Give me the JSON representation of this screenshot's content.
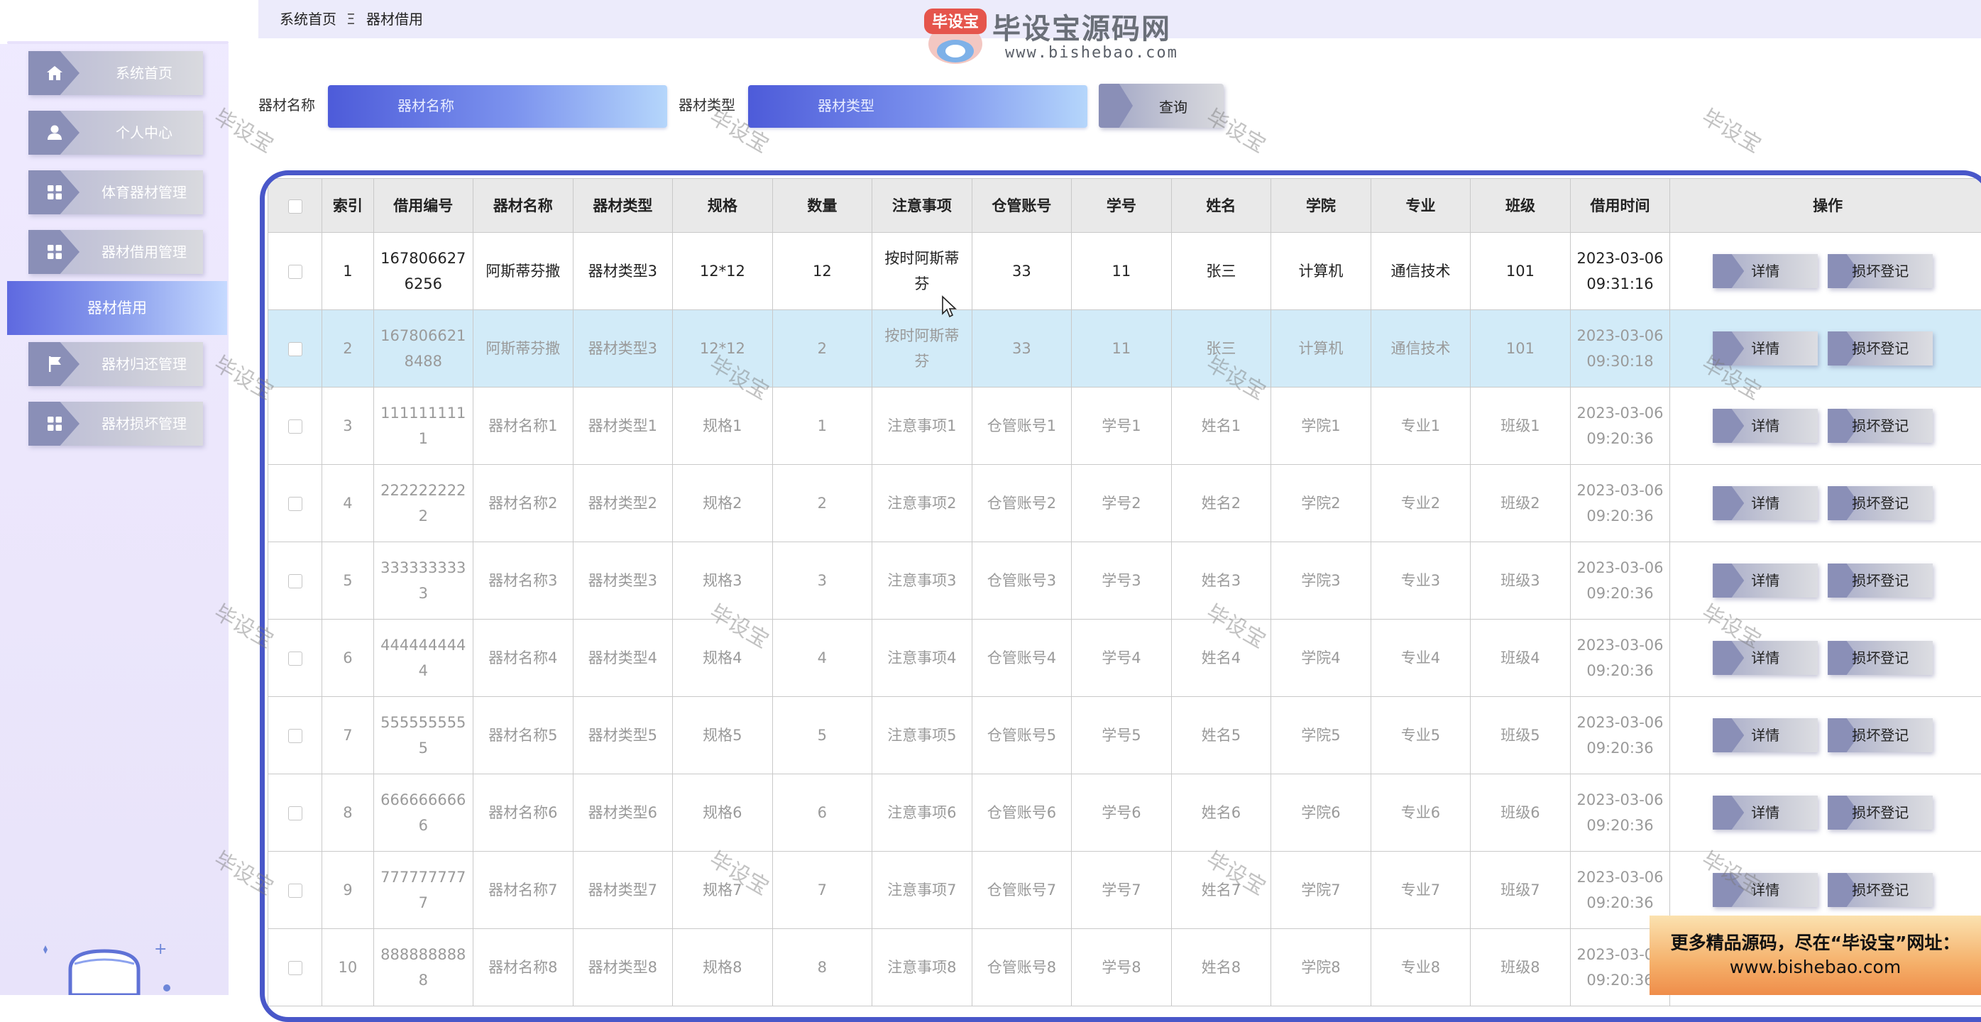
{
  "breadcrumb": {
    "home": "系统首页",
    "separator": "Ξ",
    "current": "器材借用"
  },
  "logo": {
    "badge_text": "毕设宝",
    "title": "毕设宝源码网",
    "url": "www.bishebao.com"
  },
  "sidebar": {
    "items": [
      {
        "label": "系统首页",
        "icon": "home-icon"
      },
      {
        "label": "个人中心",
        "icon": "user-icon"
      },
      {
        "label": "体育器材管理",
        "icon": "grid-icon"
      },
      {
        "label": "器材借用管理",
        "icon": "grid-icon"
      },
      {
        "label": "器材归还管理",
        "icon": "flag-icon"
      },
      {
        "label": "器材损坏管理",
        "icon": "grid-icon"
      }
    ],
    "active": "器材借用"
  },
  "search": {
    "name_label": "器材名称",
    "name_placeholder": "器材名称",
    "type_label": "器材类型",
    "type_placeholder": "器材类型",
    "query_label": "查询"
  },
  "table": {
    "headers": [
      "索引",
      "借用编号",
      "器材名称",
      "器材类型",
      "规格",
      "数量",
      "注意事项",
      "仓管账号",
      "学号",
      "姓名",
      "学院",
      "专业",
      "班级",
      "借用时间",
      "操作"
    ],
    "detail_label": "详情",
    "damage_label": "损坏登记",
    "rows": [
      [
        "1",
        "1678066276256",
        "阿斯蒂芬撒",
        "器材类型3",
        "12*12",
        "12",
        "按时阿斯蒂芬",
        "33",
        "11",
        "张三",
        "计算机",
        "通信技术",
        "101",
        "2023-03-06 09:31:16"
      ],
      [
        "2",
        "1678066218488",
        "阿斯蒂芬撒",
        "器材类型3",
        "12*12",
        "2",
        "按时阿斯蒂芬",
        "33",
        "11",
        "张三",
        "计算机",
        "通信技术",
        "101",
        "2023-03-06 09:30:18"
      ],
      [
        "3",
        "1111111111",
        "器材名称1",
        "器材类型1",
        "规格1",
        "1",
        "注意事项1",
        "仓管账号1",
        "学号1",
        "姓名1",
        "学院1",
        "专业1",
        "班级1",
        "2023-03-06 09:20:36"
      ],
      [
        "4",
        "2222222222",
        "器材名称2",
        "器材类型2",
        "规格2",
        "2",
        "注意事项2",
        "仓管账号2",
        "学号2",
        "姓名2",
        "学院2",
        "专业2",
        "班级2",
        "2023-03-06 09:20:36"
      ],
      [
        "5",
        "3333333333",
        "器材名称3",
        "器材类型3",
        "规格3",
        "3",
        "注意事项3",
        "仓管账号3",
        "学号3",
        "姓名3",
        "学院3",
        "专业3",
        "班级3",
        "2023-03-06 09:20:36"
      ],
      [
        "6",
        "4444444444",
        "器材名称4",
        "器材类型4",
        "规格4",
        "4",
        "注意事项4",
        "仓管账号4",
        "学号4",
        "姓名4",
        "学院4",
        "专业4",
        "班级4",
        "2023-03-06 09:20:36"
      ],
      [
        "7",
        "5555555555",
        "器材名称5",
        "器材类型5",
        "规格5",
        "5",
        "注意事项5",
        "仓管账号5",
        "学号5",
        "姓名5",
        "学院5",
        "专业5",
        "班级5",
        "2023-03-06 09:20:36"
      ],
      [
        "8",
        "6666666666",
        "器材名称6",
        "器材类型6",
        "规格6",
        "6",
        "注意事项6",
        "仓管账号6",
        "学号6",
        "姓名6",
        "学院6",
        "专业6",
        "班级6",
        "2023-03-06 09:20:36"
      ],
      [
        "9",
        "7777777777",
        "器材名称7",
        "器材类型7",
        "规格7",
        "7",
        "注意事项7",
        "仓管账号7",
        "学号7",
        "姓名7",
        "学院7",
        "专业7",
        "班级7",
        "2023-03-06 09:20:36"
      ],
      [
        "10",
        "8888888888",
        "器材名称8",
        "器材类型8",
        "规格8",
        "8",
        "注意事项8",
        "仓管账号8",
        "学号8",
        "姓名8",
        "学院8",
        "专业8",
        "班级8",
        "2023-03-06 09:20:36"
      ]
    ]
  },
  "watermark": "毕设宝",
  "promo": {
    "line1": "更多精品源码，尽在“毕设宝”网址：",
    "line2": "www.bishebao.com"
  },
  "colors": {
    "accent": "#4957c9",
    "sidebar_bg": "#ece7fc",
    "button_tab": "#8a8fb7",
    "row_hover": "#d2ebf8",
    "promo": "#f5b06a"
  }
}
